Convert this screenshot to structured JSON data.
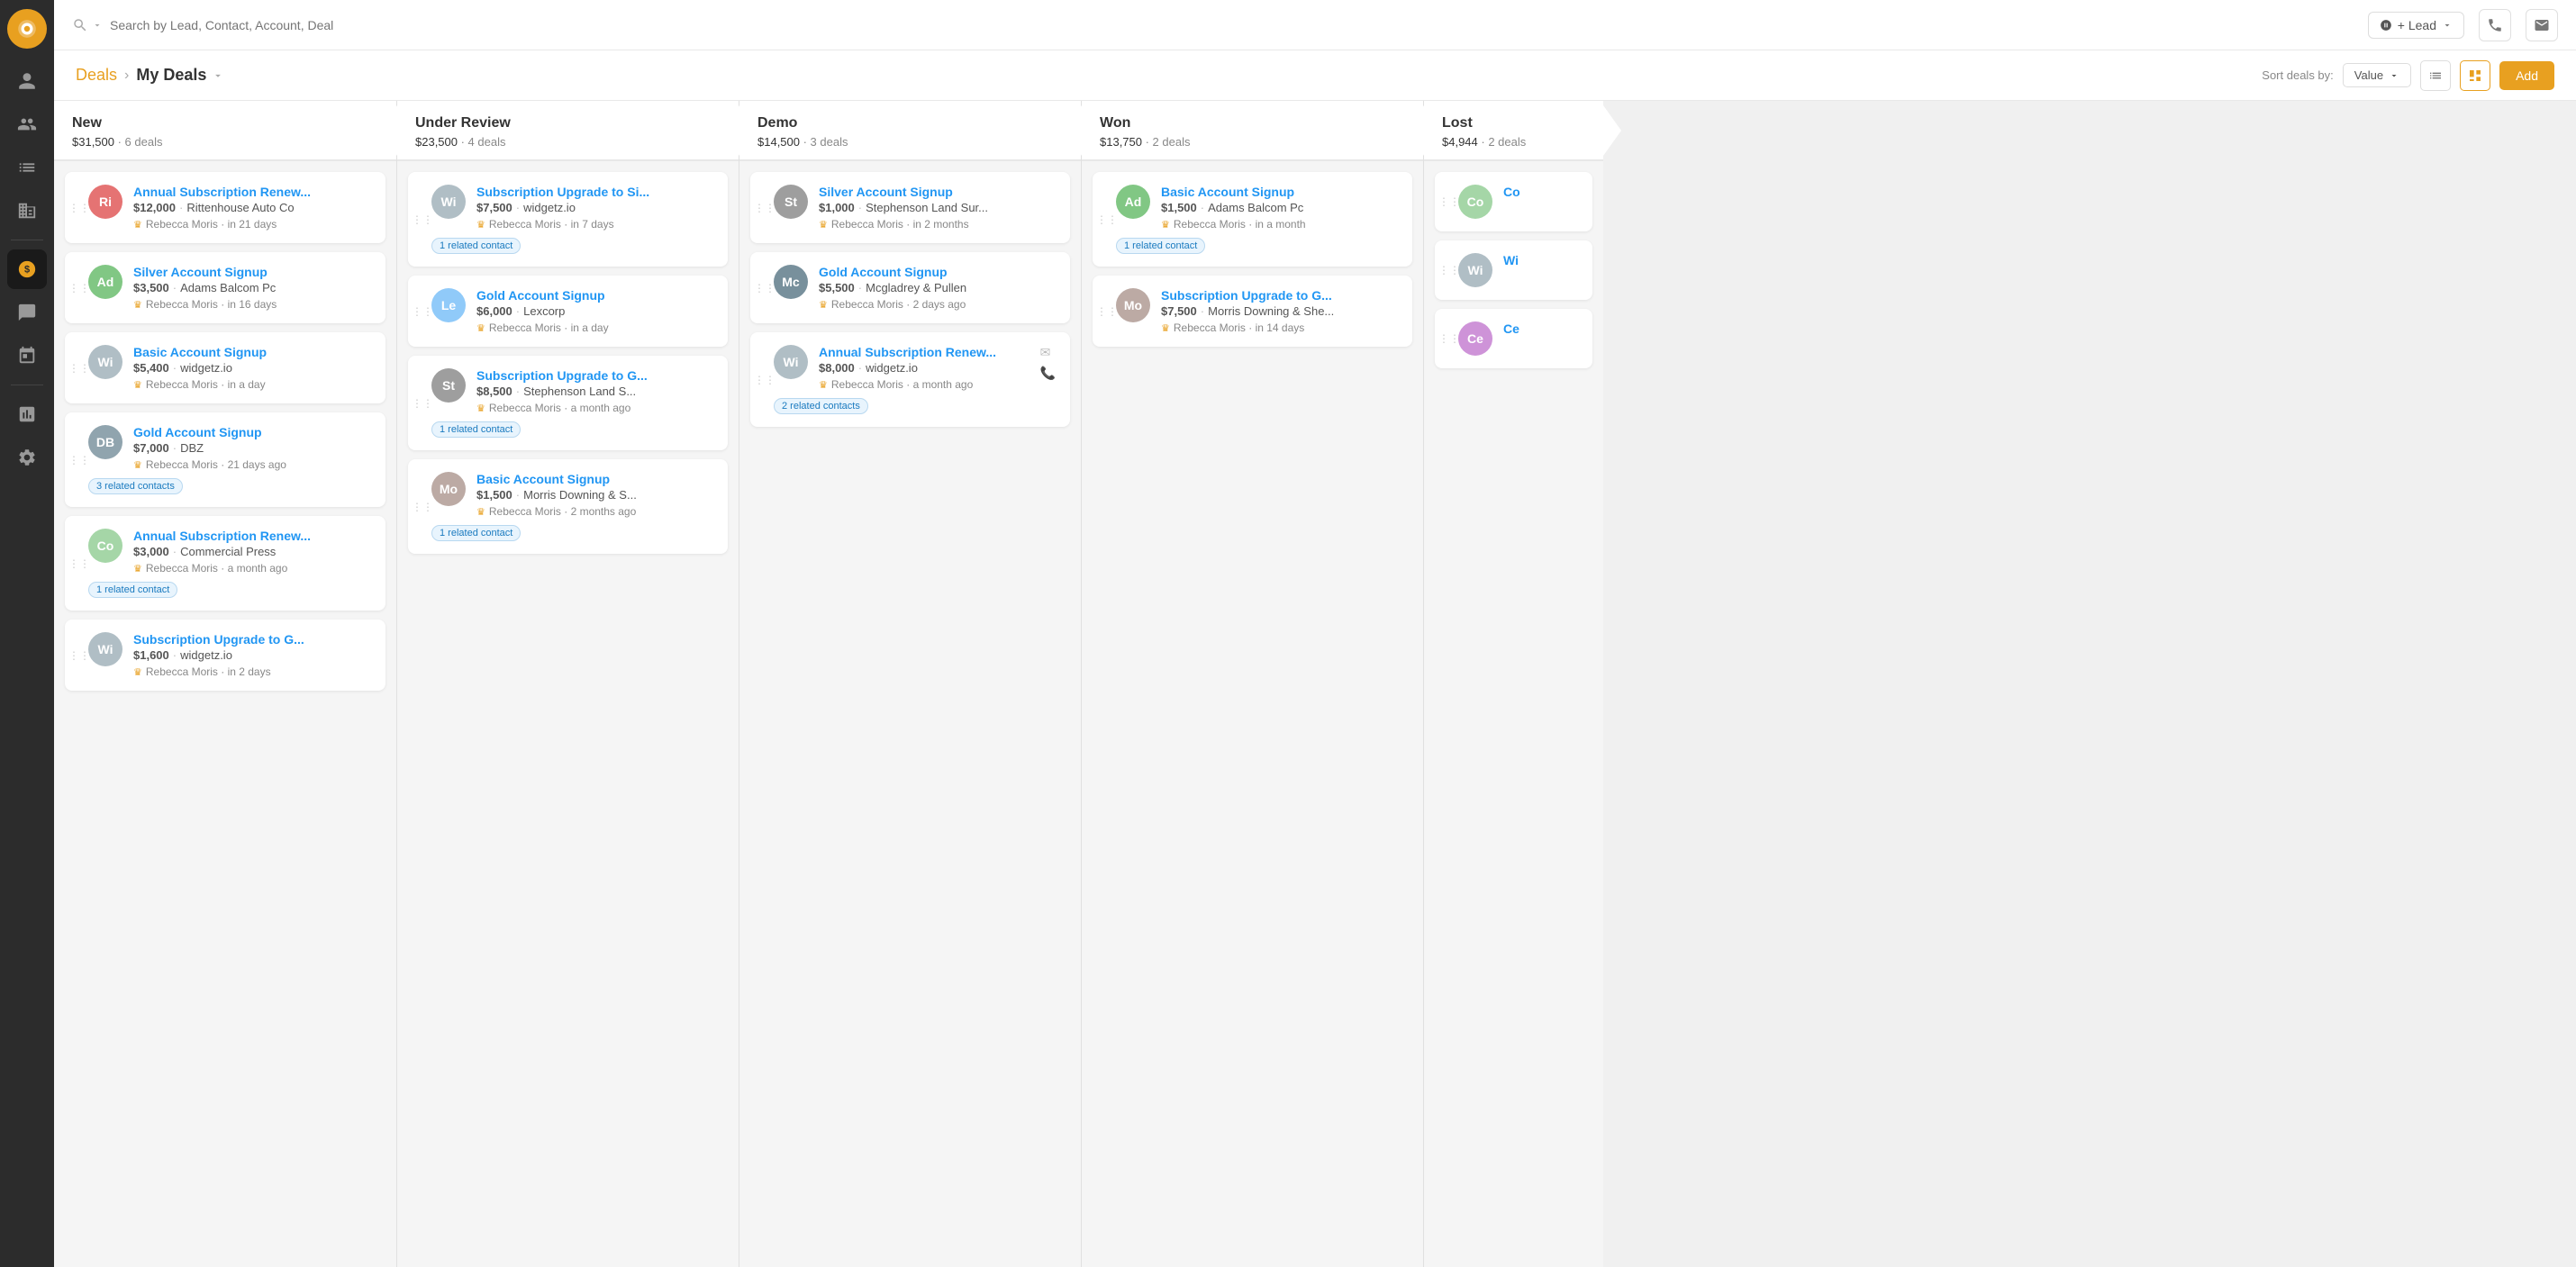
{
  "sidebar": {
    "logo_symbol": "S",
    "items": [
      {
        "id": "person",
        "label": "Contacts"
      },
      {
        "id": "user",
        "label": "Leads"
      },
      {
        "id": "chart",
        "label": "Reports"
      },
      {
        "id": "building",
        "label": "Companies"
      },
      {
        "id": "deals",
        "label": "Deals",
        "active": true
      },
      {
        "id": "chat",
        "label": "Messages"
      },
      {
        "id": "calendar",
        "label": "Calendar"
      },
      {
        "id": "analytics",
        "label": "Analytics"
      },
      {
        "id": "settings",
        "label": "Settings"
      }
    ]
  },
  "topbar": {
    "search_placeholder": "Search by Lead, Contact, Account, Deal",
    "lead_label": "+ Lead",
    "lead_dropdown_symbol": "▾"
  },
  "header": {
    "breadcrumb_link": "Deals",
    "breadcrumb_current": "My Deals",
    "sort_label": "Sort deals by:",
    "sort_value": "Value",
    "add_label": "Add"
  },
  "columns": [
    {
      "id": "new",
      "title": "New",
      "total": "$31,500",
      "count": "6 deals",
      "cards": [
        {
          "id": "c1",
          "title": "Annual Subscription Renew...",
          "amount": "$12,000",
          "company": "Rittenhouse Auto Co",
          "owner": "Rebecca Moris",
          "time": "in 21 days",
          "avatar": "Ri",
          "av_class": "av-ri",
          "badge": null
        },
        {
          "id": "c2",
          "title": "Silver Account Signup",
          "amount": "$3,500",
          "company": "Adams Balcom Pc",
          "owner": "Rebecca Moris",
          "time": "in 16 days",
          "avatar": "Ad",
          "av_class": "av-ad",
          "badge": null
        },
        {
          "id": "c3",
          "title": "Basic Account Signup",
          "amount": "$5,400",
          "company": "widgetz.io",
          "owner": "Rebecca Moris",
          "time": "in a day",
          "avatar": "Wi",
          "av_class": "av-wi",
          "badge": null
        },
        {
          "id": "c4",
          "title": "Gold Account Signup",
          "amount": "$7,000",
          "company": "DBZ",
          "owner": "Rebecca Moris",
          "time": "21 days ago",
          "avatar": "DB",
          "av_class": "av-db",
          "badge": "3 related contacts"
        },
        {
          "id": "c5",
          "title": "Annual Subscription Renew...",
          "amount": "$3,000",
          "company": "Commercial Press",
          "owner": "Rebecca Moris",
          "time": "a month ago",
          "avatar": "Co",
          "av_class": "av-co",
          "badge": "1 related contact"
        },
        {
          "id": "c6",
          "title": "Subscription Upgrade to G...",
          "amount": "$1,600",
          "company": "widgetz.io",
          "owner": "Rebecca Moris",
          "time": "in 2 days",
          "avatar": "Wi",
          "av_class": "av-wi",
          "badge": null
        }
      ]
    },
    {
      "id": "under_review",
      "title": "Under Review",
      "total": "$23,500",
      "count": "4 deals",
      "cards": [
        {
          "id": "u1",
          "title": "Subscription Upgrade to Si...",
          "amount": "$7,500",
          "company": "widgetz.io",
          "owner": "Rebecca Moris",
          "time": "in 7 days",
          "avatar": "Wi",
          "av_class": "av-wi",
          "badge": "1 related contact"
        },
        {
          "id": "u2",
          "title": "Gold Account Signup",
          "amount": "$6,000",
          "company": "Lexcorp",
          "owner": "Rebecca Moris",
          "time": "in a day",
          "avatar": "Le",
          "av_class": "av-le",
          "badge": null
        },
        {
          "id": "u3",
          "title": "Subscription Upgrade to G...",
          "amount": "$8,500",
          "company": "Stephenson Land S...",
          "owner": "Rebecca Moris",
          "time": "a month ago",
          "avatar": "St",
          "av_class": "av-st",
          "badge": "1 related contact"
        },
        {
          "id": "u4",
          "title": "Basic Account Signup",
          "amount": "$1,500",
          "company": "Morris Downing & S...",
          "owner": "Rebecca Moris",
          "time": "2 months ago",
          "avatar": "Mo",
          "av_class": "av-mo",
          "badge": "1 related contact"
        }
      ]
    },
    {
      "id": "demo",
      "title": "Demo",
      "total": "$14,500",
      "count": "3 deals",
      "cards": [
        {
          "id": "d1",
          "title": "Silver Account Signup",
          "amount": "$1,000",
          "company": "Stephenson Land Sur...",
          "owner": "Rebecca Moris",
          "time": "in 2 months",
          "avatar": "St",
          "av_class": "av-st",
          "badge": null,
          "icons": false
        },
        {
          "id": "d2",
          "title": "Gold Account Signup",
          "amount": "$5,500",
          "company": "Mcgladrey & Pullen",
          "owner": "Rebecca Moris",
          "time": "2 days ago",
          "avatar": "Mc",
          "av_class": "av-mc",
          "badge": null,
          "icons": false
        },
        {
          "id": "d3",
          "title": "Annual Subscription Renew...",
          "amount": "$8,000",
          "company": "widgetz.io",
          "owner": "Rebecca Moris",
          "time": "a month ago",
          "avatar": "Wi",
          "av_class": "av-wi",
          "badge": "2 related contacts",
          "icons": true
        }
      ]
    },
    {
      "id": "won",
      "title": "Won",
      "total": "$13,750",
      "count": "2 deals",
      "cards": [
        {
          "id": "w1",
          "title": "Basic Account Signup",
          "amount": "$1,500",
          "company": "Adams Balcom Pc",
          "owner": "Rebecca Moris",
          "time": "in a month",
          "avatar": "Ad",
          "av_class": "av-ad",
          "badge": "1 related contact"
        },
        {
          "id": "w2",
          "title": "Subscription Upgrade to G...",
          "amount": "$7,500",
          "company": "Morris Downing & She...",
          "owner": "Rebecca Moris",
          "time": "in 14 days",
          "avatar": "Mo",
          "av_class": "av-mo",
          "badge": null
        }
      ]
    },
    {
      "id": "lost",
      "title": "Lost",
      "total": "$4,944",
      "count": "2 deals",
      "cards": [
        {
          "id": "l1",
          "title": "Co",
          "amount": "",
          "company": "",
          "owner": "",
          "time": "",
          "avatar": "Co",
          "av_class": "av-co",
          "badge": null
        },
        {
          "id": "l2",
          "title": "Wi",
          "amount": "",
          "company": "",
          "owner": "",
          "time": "",
          "avatar": "Wi",
          "av_class": "av-wi",
          "badge": null
        },
        {
          "id": "l3",
          "title": "Ce",
          "amount": "",
          "company": "",
          "owner": "",
          "time": "",
          "avatar": "Ce",
          "av_class": "av-ce",
          "badge": null
        }
      ]
    }
  ]
}
